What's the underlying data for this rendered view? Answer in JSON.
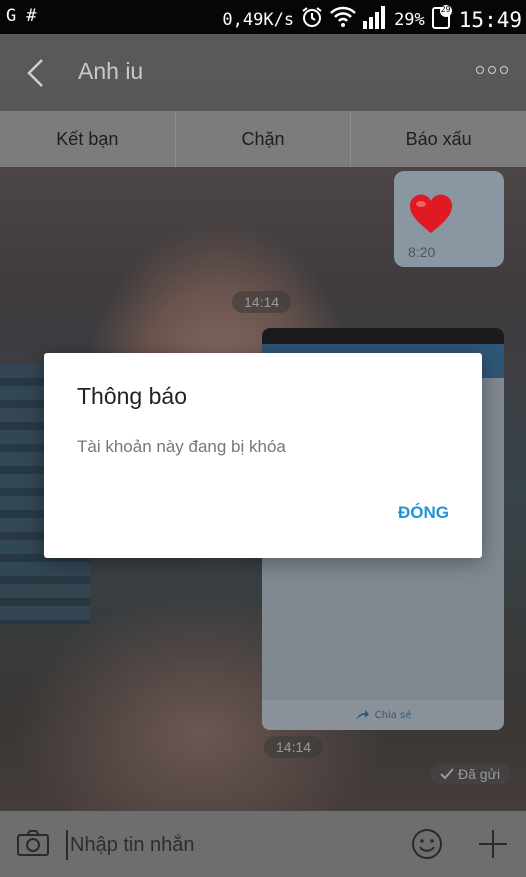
{
  "status_bar": {
    "left_icons": [
      "G",
      "#"
    ],
    "network_speed": "0,49K/s",
    "battery_percent": "29%",
    "notification_count": "29",
    "time": "15:49"
  },
  "header": {
    "title": "Anh iu",
    "back_icon": "chevron-left-icon",
    "more_icon": "more-dots-icon"
  },
  "actions": [
    {
      "label": "Kết bạn"
    },
    {
      "label": "Chặn"
    },
    {
      "label": "Báo xấu"
    }
  ],
  "messages": {
    "heart_time": "8:20",
    "time_pill_1": "14:14",
    "time_pill_2": "14:14",
    "shared_image_footer": "Chia sẻ",
    "sent_status": "Đã gửi"
  },
  "input": {
    "placeholder": "Nhập tin nhắn"
  },
  "dialog": {
    "title": "Thông báo",
    "message": "Tài khoản này đang bị khóa",
    "button": "ĐÓNG"
  },
  "colors": {
    "accent": "#1e93d6",
    "heart": "#e01a22"
  }
}
